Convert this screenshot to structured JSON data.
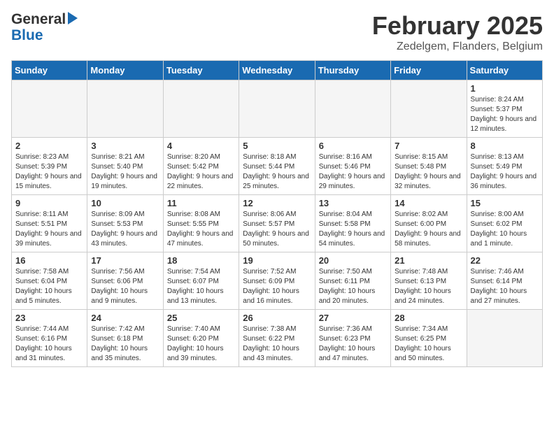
{
  "header": {
    "logo_line1": "General",
    "logo_line2": "Blue",
    "month_year": "February 2025",
    "location": "Zedelgem, Flanders, Belgium"
  },
  "days_of_week": [
    "Sunday",
    "Monday",
    "Tuesday",
    "Wednesday",
    "Thursday",
    "Friday",
    "Saturday"
  ],
  "weeks": [
    [
      {
        "day": "",
        "info": ""
      },
      {
        "day": "",
        "info": ""
      },
      {
        "day": "",
        "info": ""
      },
      {
        "day": "",
        "info": ""
      },
      {
        "day": "",
        "info": ""
      },
      {
        "day": "",
        "info": ""
      },
      {
        "day": "1",
        "info": "Sunrise: 8:24 AM\nSunset: 5:37 PM\nDaylight: 9 hours and 12 minutes."
      }
    ],
    [
      {
        "day": "2",
        "info": "Sunrise: 8:23 AM\nSunset: 5:39 PM\nDaylight: 9 hours and 15 minutes."
      },
      {
        "day": "3",
        "info": "Sunrise: 8:21 AM\nSunset: 5:40 PM\nDaylight: 9 hours and 19 minutes."
      },
      {
        "day": "4",
        "info": "Sunrise: 8:20 AM\nSunset: 5:42 PM\nDaylight: 9 hours and 22 minutes."
      },
      {
        "day": "5",
        "info": "Sunrise: 8:18 AM\nSunset: 5:44 PM\nDaylight: 9 hours and 25 minutes."
      },
      {
        "day": "6",
        "info": "Sunrise: 8:16 AM\nSunset: 5:46 PM\nDaylight: 9 hours and 29 minutes."
      },
      {
        "day": "7",
        "info": "Sunrise: 8:15 AM\nSunset: 5:48 PM\nDaylight: 9 hours and 32 minutes."
      },
      {
        "day": "8",
        "info": "Sunrise: 8:13 AM\nSunset: 5:49 PM\nDaylight: 9 hours and 36 minutes."
      }
    ],
    [
      {
        "day": "9",
        "info": "Sunrise: 8:11 AM\nSunset: 5:51 PM\nDaylight: 9 hours and 39 minutes."
      },
      {
        "day": "10",
        "info": "Sunrise: 8:09 AM\nSunset: 5:53 PM\nDaylight: 9 hours and 43 minutes."
      },
      {
        "day": "11",
        "info": "Sunrise: 8:08 AM\nSunset: 5:55 PM\nDaylight: 9 hours and 47 minutes."
      },
      {
        "day": "12",
        "info": "Sunrise: 8:06 AM\nSunset: 5:57 PM\nDaylight: 9 hours and 50 minutes."
      },
      {
        "day": "13",
        "info": "Sunrise: 8:04 AM\nSunset: 5:58 PM\nDaylight: 9 hours and 54 minutes."
      },
      {
        "day": "14",
        "info": "Sunrise: 8:02 AM\nSunset: 6:00 PM\nDaylight: 9 hours and 58 minutes."
      },
      {
        "day": "15",
        "info": "Sunrise: 8:00 AM\nSunset: 6:02 PM\nDaylight: 10 hours and 1 minute."
      }
    ],
    [
      {
        "day": "16",
        "info": "Sunrise: 7:58 AM\nSunset: 6:04 PM\nDaylight: 10 hours and 5 minutes."
      },
      {
        "day": "17",
        "info": "Sunrise: 7:56 AM\nSunset: 6:06 PM\nDaylight: 10 hours and 9 minutes."
      },
      {
        "day": "18",
        "info": "Sunrise: 7:54 AM\nSunset: 6:07 PM\nDaylight: 10 hours and 13 minutes."
      },
      {
        "day": "19",
        "info": "Sunrise: 7:52 AM\nSunset: 6:09 PM\nDaylight: 10 hours and 16 minutes."
      },
      {
        "day": "20",
        "info": "Sunrise: 7:50 AM\nSunset: 6:11 PM\nDaylight: 10 hours and 20 minutes."
      },
      {
        "day": "21",
        "info": "Sunrise: 7:48 AM\nSunset: 6:13 PM\nDaylight: 10 hours and 24 minutes."
      },
      {
        "day": "22",
        "info": "Sunrise: 7:46 AM\nSunset: 6:14 PM\nDaylight: 10 hours and 27 minutes."
      }
    ],
    [
      {
        "day": "23",
        "info": "Sunrise: 7:44 AM\nSunset: 6:16 PM\nDaylight: 10 hours and 31 minutes."
      },
      {
        "day": "24",
        "info": "Sunrise: 7:42 AM\nSunset: 6:18 PM\nDaylight: 10 hours and 35 minutes."
      },
      {
        "day": "25",
        "info": "Sunrise: 7:40 AM\nSunset: 6:20 PM\nDaylight: 10 hours and 39 minutes."
      },
      {
        "day": "26",
        "info": "Sunrise: 7:38 AM\nSunset: 6:22 PM\nDaylight: 10 hours and 43 minutes."
      },
      {
        "day": "27",
        "info": "Sunrise: 7:36 AM\nSunset: 6:23 PM\nDaylight: 10 hours and 47 minutes."
      },
      {
        "day": "28",
        "info": "Sunrise: 7:34 AM\nSunset: 6:25 PM\nDaylight: 10 hours and 50 minutes."
      },
      {
        "day": "",
        "info": ""
      }
    ]
  ]
}
